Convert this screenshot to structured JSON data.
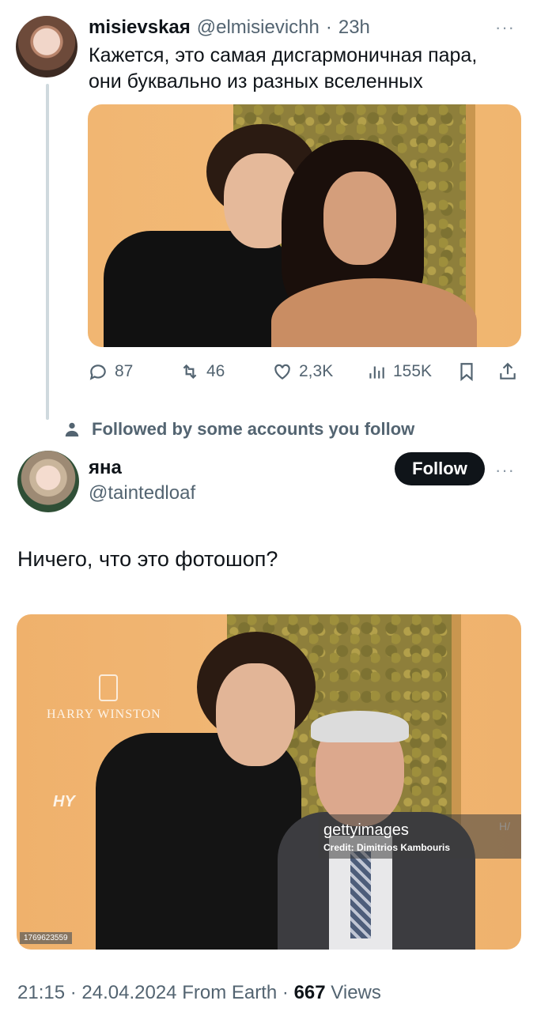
{
  "parent_tweet": {
    "display_name": "misievskaя",
    "handle": "@elmisievichh",
    "separator": "·",
    "time": "23h",
    "more": "···",
    "text_lines": [
      "Кажется, это самая дисгармоничная пара,",
      "они буквально из разных вселенных"
    ],
    "actions": {
      "replies": "87",
      "reposts": "46",
      "likes": "2,3K",
      "views": "155K"
    }
  },
  "context": {
    "followed_by": "Followed by some accounts you follow"
  },
  "main_tweet": {
    "display_name": "яна",
    "handle": "@taintedloaf",
    "follow_label": "Follow",
    "more": "···",
    "text": "Ничего, что это фотошоп?",
    "image_overlays": {
      "brand": "HARRY WINSTON",
      "sponsor": "H",
      "sponsor_suffix": "HY",
      "getty": "gettyimages",
      "credit": "Credit: Dimitrios Kambouris",
      "image_id": "1769623559",
      "edge_text": "H/"
    },
    "meta": {
      "time": "21:15",
      "date": "24.04.2024",
      "source": "From Earth",
      "separator": "·",
      "views_count": "667",
      "views_label": "Views"
    }
  }
}
